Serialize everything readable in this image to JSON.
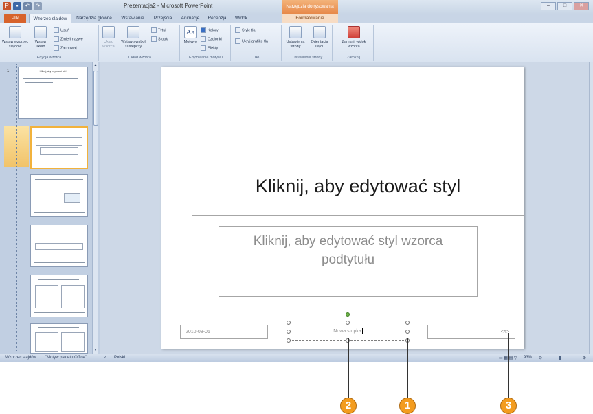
{
  "titlebar": {
    "app_title": "Prezentacja2 - Microsoft PowerPoint",
    "context_title": "Narzędzia do rysowania"
  },
  "tabs": {
    "file": "Plik",
    "items": [
      "Wzorzec slajdów",
      "Narzędzia główne",
      "Wstawianie",
      "Przejścia",
      "Animacje",
      "Recenzja",
      "Widok"
    ],
    "context": "Formatowanie"
  },
  "ribbon": {
    "groups": [
      {
        "label": "Edycja wzorca",
        "buttons": [
          "Wstaw wzorzec slajdów",
          "Wstaw układ"
        ],
        "small": [
          "Usuń",
          "Zmień nazwę",
          "Zachowaj"
        ]
      },
      {
        "label": "Układ wzorca",
        "buttons": [
          "Układ wzorca",
          "Wstaw symbol zastępczy"
        ],
        "small": [
          "Tytuł",
          "Stopki"
        ]
      },
      {
        "label": "Edytowanie motywu",
        "buttons": [
          "Motywy"
        ],
        "small": [
          "Kolory",
          "Czcionki",
          "Efekty"
        ]
      },
      {
        "label": "Tło",
        "small": [
          "Style tła",
          "Ukryj grafikę tła"
        ]
      },
      {
        "label": "Ustawienia strony",
        "buttons": [
          "Ustawienia strony",
          "Orientacja slajdu"
        ]
      },
      {
        "label": "Zamknij",
        "buttons": [
          "Zamknij widok wzorca"
        ]
      }
    ]
  },
  "thumbnails": {
    "index": "1",
    "master_title": "Kliknij, aby edytować styl"
  },
  "slide": {
    "title": "Kliknij, aby edytować styl",
    "subtitle_line1": "Kliknij, aby edytować styl wzorca",
    "subtitle_line2": "podtytułu",
    "date": "2010-08-06",
    "footer": "Nowa stopka",
    "number": "<#>"
  },
  "statusbar": {
    "view": "Wzorzec slajdów",
    "theme": "\"Motyw pakietu Office\"",
    "language": "Polski",
    "zoom": "93%"
  },
  "callouts": [
    "2",
    "1",
    "3"
  ]
}
